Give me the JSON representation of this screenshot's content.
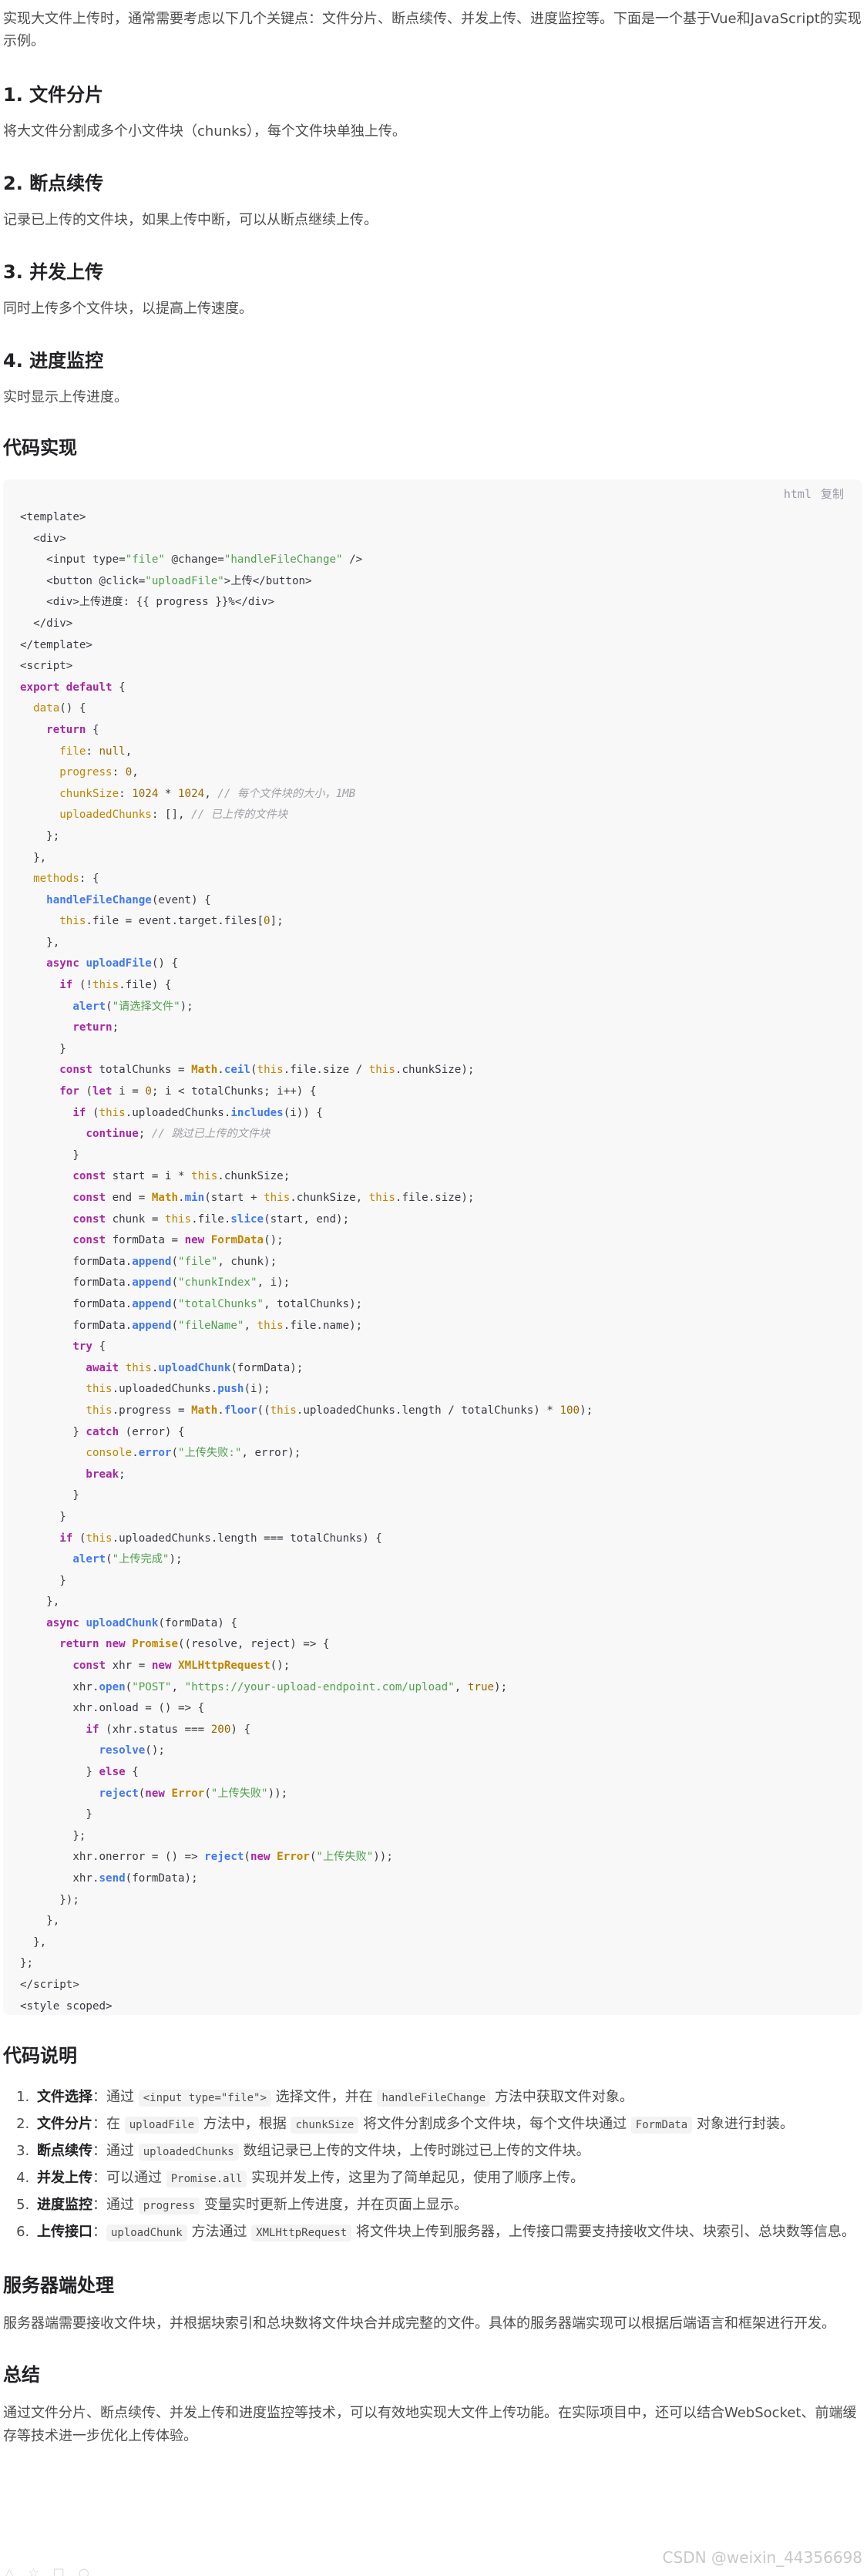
{
  "intro": "实现大文件上传时，通常需要考虑以下几个关键点：文件分片、断点续传、并发上传、进度监控等。下面是一个基于Vue和JavaScript的实现示例。",
  "sections": [
    {
      "title": "1. 文件分片",
      "text": "将大文件分割成多个小文件块（chunks），每个文件块单独上传。"
    },
    {
      "title": "2. 断点续传",
      "text": "记录已上传的文件块，如果上传中断，可以从断点继续上传。"
    },
    {
      "title": "3. 并发上传",
      "text": "同时上传多个文件块，以提高上传速度。"
    },
    {
      "title": "4. 进度监控",
      "text": "实时显示上传进度。"
    }
  ],
  "code_heading": "代码实现",
  "code_tools": {
    "lang": "html",
    "copy": "复制"
  },
  "notes_heading": "代码说明",
  "notes": [
    {
      "label": "文件选择",
      "pre": "：通过 ",
      "c1": "<input type=\"file\">",
      "mid": " 选择文件，并在 ",
      "c2": "handleFileChange",
      "post": " 方法中获取文件对象。"
    },
    {
      "label": "文件分片",
      "pre": "：在 ",
      "c1": "uploadFile",
      "mid": " 方法中，根据 ",
      "c2": "chunkSize",
      "post": " 将文件分割成多个文件块，每个文件块通过 ",
      "c3": "FormData",
      "post2": " 对象进行封装。"
    },
    {
      "label": "断点续传",
      "pre": "：通过 ",
      "c1": "uploadedChunks",
      "post": " 数组记录已上传的文件块，上传时跳过已上传的文件块。"
    },
    {
      "label": "并发上传",
      "pre": "：可以通过 ",
      "c1": "Promise.all",
      "post": " 实现并发上传，这里为了简单起见，使用了顺序上传。"
    },
    {
      "label": "进度监控",
      "pre": "：通过 ",
      "c1": "progress",
      "post": " 变量实时更新上传进度，并在页面上显示。"
    },
    {
      "label": "上传接口",
      "pre": "：",
      "c1": "uploadChunk",
      "mid": " 方法通过 ",
      "c2": "XMLHttpRequest",
      "post": " 将文件块上传到服务器，上传接口需要支持接收文件块、块索引、总块数等信息。"
    }
  ],
  "server_heading": "服务器端处理",
  "server_text": "服务器端需要接收文件块，并根据块索引和总块数将文件块合并成完整的文件。具体的服务器端实现可以根据后端语言和框架进行开发。",
  "summary_heading": "总结",
  "summary_text": "通过文件分片、断点续传、并发上传和进度监控等技术，可以有效地实现大文件上传功能。在实际项目中，还可以结合WebSocket、前端缓存等技术进一步优化上传体验。",
  "watermark": "CSDN @weixin_44356698"
}
